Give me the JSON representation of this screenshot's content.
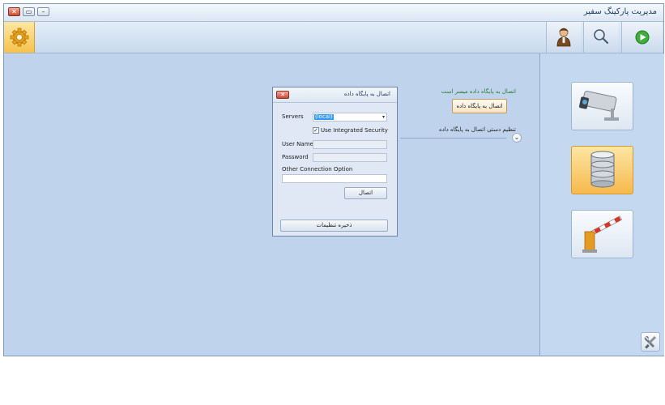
{
  "window": {
    "title": "مدیریت پارکینگ سفیر",
    "close_glyph": "✕",
    "maximize_glyph": "▭",
    "minimize_glyph": "–"
  },
  "toolbar": {
    "icons": [
      "gear-icon",
      "user-icon",
      "search-icon",
      "play-icon"
    ]
  },
  "panel": {
    "icons": [
      "security-camera-icon",
      "database-icon",
      "parking-barrier-icon",
      "tools-icon"
    ]
  },
  "connection": {
    "status_text": "اتصال به پایگاه داده میسر است",
    "connect_button_label": "اتصال به پایگاه داده",
    "manual_label": "تنظیم دستی اتصال به پایگاه داده",
    "expand_glyph": "⌄"
  },
  "dialog": {
    "title": "اتصال به پایگاه داده",
    "close_glyph": "✕",
    "servers_label": "Servers",
    "servers_value": "(local)",
    "combo_arrow": "▾",
    "integrated_security_label": "Use Integrated Security",
    "integrated_security_checked": true,
    "check_glyph": "✓",
    "username_label": "User Name",
    "username_value": "",
    "password_label": "Password",
    "password_value": "",
    "other_option_label": "Other Connection Option",
    "other_option_value": "",
    "connect_label": "اتصال",
    "save_label": "ذخیره تنظیمات"
  },
  "colors": {
    "accent_orange": "#f7c24a",
    "status_green": "#2e7d32",
    "background_blue": "#bfd4ec"
  }
}
